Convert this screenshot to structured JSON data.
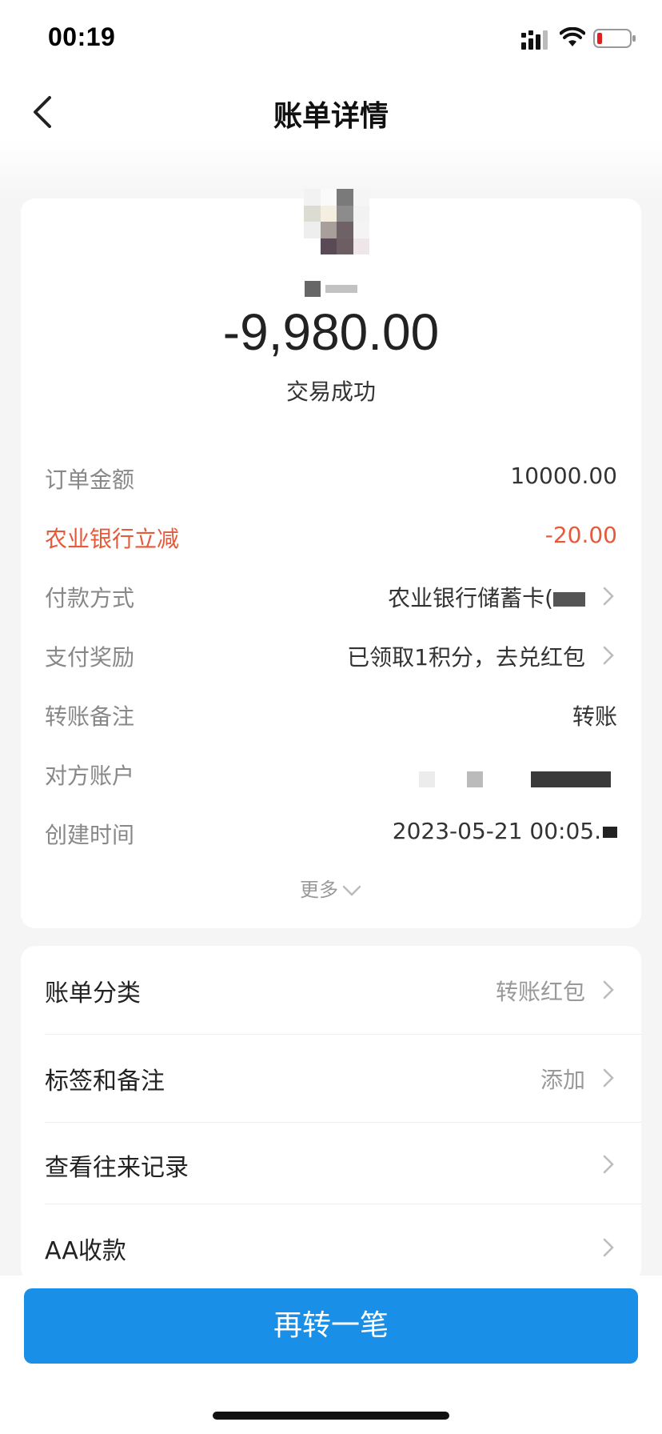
{
  "status_bar": {
    "time": "00:19"
  },
  "nav": {
    "title": "账单详情"
  },
  "summary": {
    "amount": "-9,980.00",
    "status": "交易成功"
  },
  "details": [
    {
      "label": "订单金额",
      "value": "10000.00"
    },
    {
      "label": "农业银行立减",
      "value": "-20.00"
    },
    {
      "label": "付款方式",
      "value": "农业银行储蓄卡("
    },
    {
      "label": "支付奖励",
      "value": "已领取1积分，去兑红包"
    },
    {
      "label": "转账备注",
      "value": "转账"
    },
    {
      "label": "对方账户",
      "value": ""
    },
    {
      "label": "创建时间",
      "value": "2023-05-21 00:05."
    }
  ],
  "more_label": "更多",
  "list": [
    {
      "label": "账单分类",
      "value": "转账红包"
    },
    {
      "label": "标签和备注",
      "value": "添加"
    },
    {
      "label": "查看往来记录",
      "value": ""
    },
    {
      "label": "AA收款",
      "value": ""
    }
  ],
  "cta_label": "再转一笔",
  "colors": {
    "accent": "#1a8fe8",
    "discount": "#e55a3b"
  }
}
